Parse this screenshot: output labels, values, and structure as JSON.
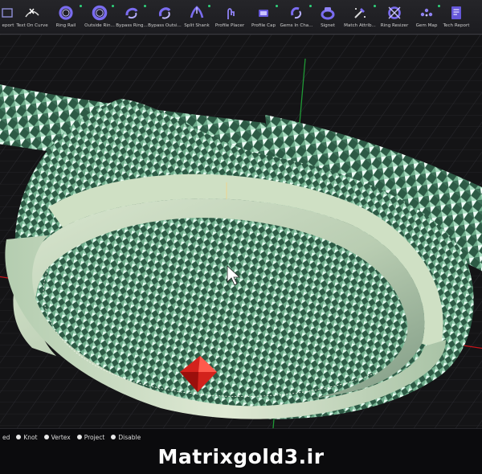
{
  "toolbar": {
    "items": [
      {
        "label": "eport",
        "icon": "export-icon"
      },
      {
        "label": "Text On Curve",
        "icon": "text-on-curve-icon"
      },
      {
        "label": "Ring Rail",
        "icon": "ring-rail-icon"
      },
      {
        "label": "Outside Rin...",
        "icon": "outside-ring-icon"
      },
      {
        "label": "Bypass Ring...",
        "icon": "bypass-ring-icon"
      },
      {
        "label": "Bypass Outsi...",
        "icon": "bypass-outside-icon"
      },
      {
        "label": "Split Shank",
        "icon": "split-shank-icon"
      },
      {
        "label": "Profile Placer",
        "icon": "profile-placer-icon"
      },
      {
        "label": "Profile Cap",
        "icon": "profile-cap-icon"
      },
      {
        "label": "Gems In Cha...",
        "icon": "gems-in-channel-icon"
      },
      {
        "label": "Signet",
        "icon": "signet-icon"
      },
      {
        "label": "Match Attrib...",
        "icon": "match-attributes-icon"
      },
      {
        "label": "Ring Resizer",
        "icon": "ring-resizer-icon"
      },
      {
        "label": "Gem Map",
        "icon": "gem-map-icon"
      },
      {
        "label": "Tech Report",
        "icon": "tech-report-icon"
      }
    ]
  },
  "snaps": [
    {
      "label": "ed"
    },
    {
      "label": "Knot"
    },
    {
      "label": "Vertex"
    },
    {
      "label": "Project"
    },
    {
      "label": "Disable"
    }
  ],
  "watermark": "Matrixgold3.ir",
  "colors": {
    "ring_green": "#6fae8c",
    "axis_red": "#c8141c",
    "axis_green": "#1f9a36",
    "gem_red": "#d3221c",
    "toolbar_accent": "#7a6cf0"
  }
}
